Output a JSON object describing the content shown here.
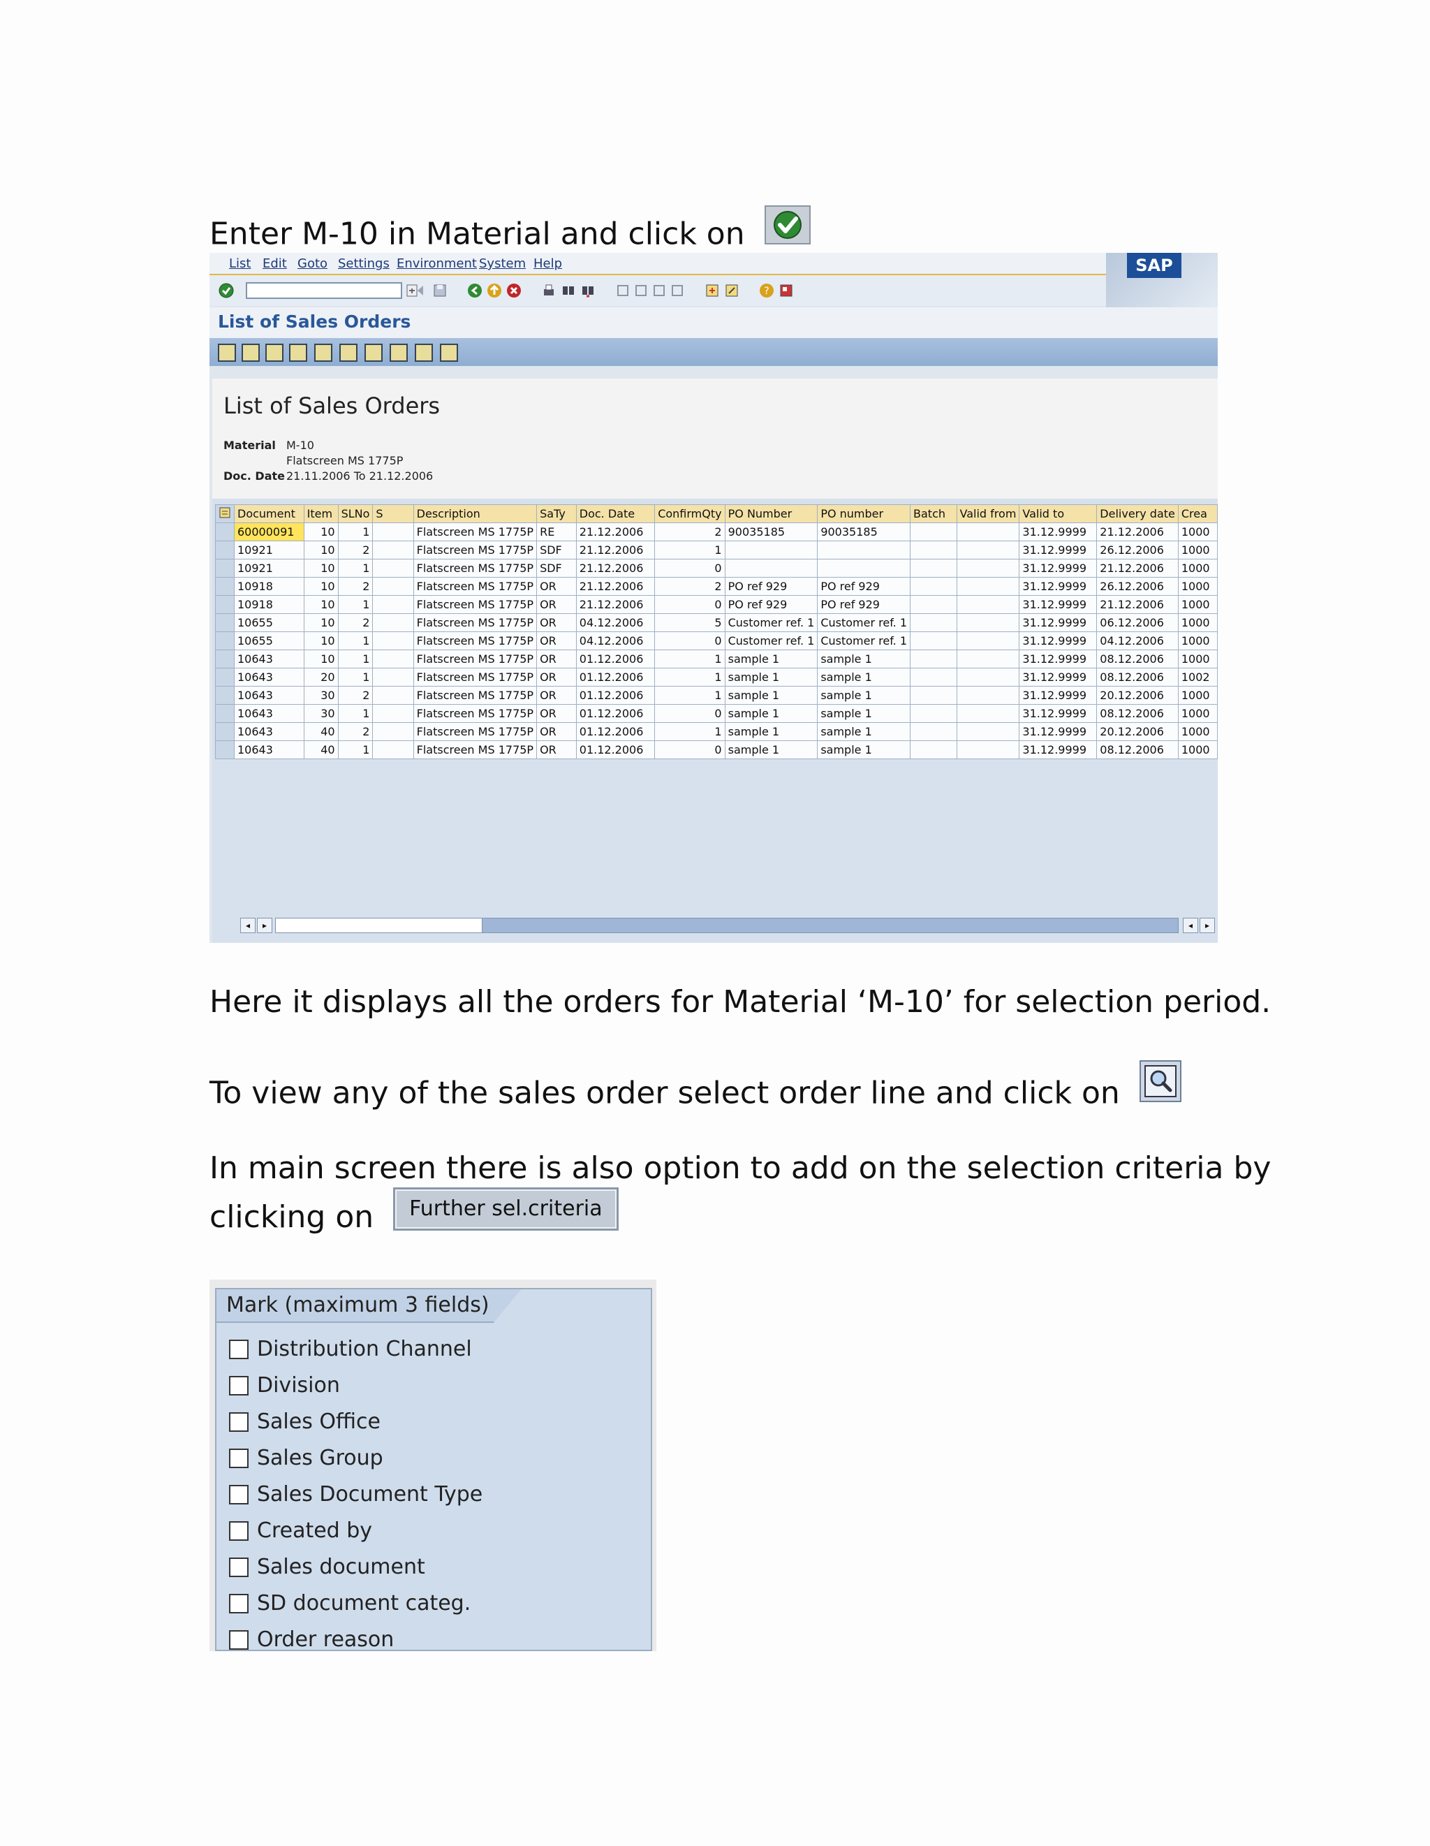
{
  "instructions": {
    "step1": "Enter M-10 in Material and click on",
    "step2": "Here it displays all the orders for Material ‘M-10’ for selection period.",
    "step3": "To view any of the sales order select order line and click on",
    "step4_line1": "In main screen there is also option to add on the selection criteria by",
    "step4_line2": "clicking on",
    "further_button": "Further sel.criteria"
  },
  "sap": {
    "menu": [
      "List",
      "Edit",
      "Goto",
      "Settings",
      "Environment",
      "System",
      "Help"
    ],
    "logo": "SAP",
    "screen_title": "List of Sales Orders",
    "report": {
      "title": "List of Sales Orders",
      "material_label": "Material",
      "material_value": "M-10",
      "material_desc": "Flatscreen MS 1775P",
      "docdate_label": "Doc. Date",
      "docdate_value": "21.11.2006 To 21.12.2006"
    },
    "columns": [
      "Document",
      "Item",
      "SLNo",
      "S",
      "Description",
      "SaTy",
      "Doc. Date",
      "ConfirmQty",
      "PO Number",
      "PO number",
      "Batch",
      "Valid from",
      "Valid to",
      "Delivery date",
      "Crea"
    ],
    "rows": [
      [
        "60000091",
        "10",
        "1",
        "",
        "Flatscreen MS 1775P",
        "RE",
        "21.12.2006",
        "2",
        "90035185",
        "90035185",
        "",
        "",
        "31.12.9999",
        "21.12.2006",
        "1000"
      ],
      [
        "10921",
        "10",
        "2",
        "",
        "Flatscreen MS 1775P",
        "SDF",
        "21.12.2006",
        "1",
        "",
        "",
        "",
        "",
        "31.12.9999",
        "26.12.2006",
        "1000"
      ],
      [
        "10921",
        "10",
        "1",
        "",
        "Flatscreen MS 1775P",
        "SDF",
        "21.12.2006",
        "0",
        "",
        "",
        "",
        "",
        "31.12.9999",
        "21.12.2006",
        "1000"
      ],
      [
        "10918",
        "10",
        "2",
        "",
        "Flatscreen MS 1775P",
        "OR",
        "21.12.2006",
        "2",
        "PO ref 929",
        "PO ref 929",
        "",
        "",
        "31.12.9999",
        "26.12.2006",
        "1000"
      ],
      [
        "10918",
        "10",
        "1",
        "",
        "Flatscreen MS 1775P",
        "OR",
        "21.12.2006",
        "0",
        "PO ref 929",
        "PO ref 929",
        "",
        "",
        "31.12.9999",
        "21.12.2006",
        "1000"
      ],
      [
        "10655",
        "10",
        "2",
        "",
        "Flatscreen MS 1775P",
        "OR",
        "04.12.2006",
        "5",
        "Customer ref. 1",
        "Customer ref. 1",
        "",
        "",
        "31.12.9999",
        "06.12.2006",
        "1000"
      ],
      [
        "10655",
        "10",
        "1",
        "",
        "Flatscreen MS 1775P",
        "OR",
        "04.12.2006",
        "0",
        "Customer ref. 1",
        "Customer ref. 1",
        "",
        "",
        "31.12.9999",
        "04.12.2006",
        "1000"
      ],
      [
        "10643",
        "10",
        "1",
        "",
        "Flatscreen MS 1775P",
        "OR",
        "01.12.2006",
        "1",
        "sample 1",
        "sample 1",
        "",
        "",
        "31.12.9999",
        "08.12.2006",
        "1000"
      ],
      [
        "10643",
        "20",
        "1",
        "",
        "Flatscreen MS 1775P",
        "OR",
        "01.12.2006",
        "1",
        "sample 1",
        "sample 1",
        "",
        "",
        "31.12.9999",
        "08.12.2006",
        "1002"
      ],
      [
        "10643",
        "30",
        "2",
        "",
        "Flatscreen MS 1775P",
        "OR",
        "01.12.2006",
        "1",
        "sample 1",
        "sample 1",
        "",
        "",
        "31.12.9999",
        "20.12.2006",
        "1000"
      ],
      [
        "10643",
        "30",
        "1",
        "",
        "Flatscreen MS 1775P",
        "OR",
        "01.12.2006",
        "0",
        "sample 1",
        "sample 1",
        "",
        "",
        "31.12.9999",
        "08.12.2006",
        "1000"
      ],
      [
        "10643",
        "40",
        "2",
        "",
        "Flatscreen MS 1775P",
        "OR",
        "01.12.2006",
        "1",
        "sample 1",
        "sample 1",
        "",
        "",
        "31.12.9999",
        "20.12.2006",
        "1000"
      ],
      [
        "10643",
        "40",
        "1",
        "",
        "Flatscreen MS 1775P",
        "OR",
        "01.12.2006",
        "0",
        "sample 1",
        "sample 1",
        "",
        "",
        "31.12.9999",
        "08.12.2006",
        "1000"
      ]
    ]
  },
  "mark_panel": {
    "title": "Mark (maximum 3 fields)",
    "options": [
      "Distribution Channel",
      "Division",
      "Sales Office",
      "Sales Group",
      "Sales Document Type",
      "Created by",
      "Sales document",
      "SD document categ.",
      "Order reason"
    ]
  },
  "icons": {
    "execute": "green-check-execute-icon",
    "display": "magnifier-display-icon"
  }
}
